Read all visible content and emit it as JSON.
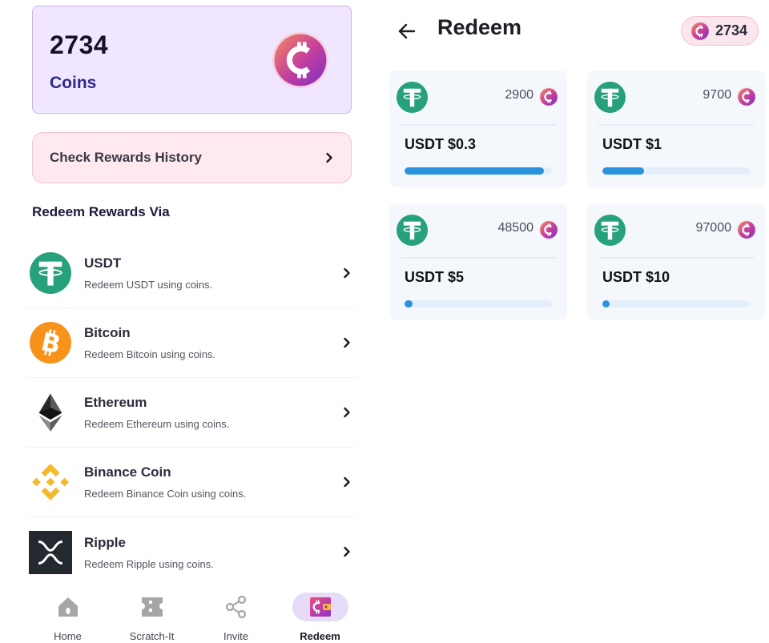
{
  "left": {
    "balance": {
      "amount": "2734",
      "label": "Coins",
      "icon": "coin-icon"
    },
    "history_button": {
      "label": "Check Rewards History",
      "icon": "chevron-right-icon"
    },
    "section_title": "Redeem Rewards Via",
    "methods": [
      {
        "name": "USDT",
        "desc": "Redeem USDT using coins.",
        "icon": "tether-icon",
        "color": "#26a17b"
      },
      {
        "name": "Bitcoin",
        "desc": "Redeem Bitcoin using coins.",
        "icon": "bitcoin-icon",
        "color": "#f7931a"
      },
      {
        "name": "Ethereum",
        "desc": "Redeem Ethereum using coins.",
        "icon": "ethereum-icon",
        "color": "#3c3c3d"
      },
      {
        "name": "Binance Coin",
        "desc": "Redeem Binance Coin using coins.",
        "icon": "binance-icon",
        "color": "#f3ba2f"
      },
      {
        "name": "Ripple",
        "desc": "Redeem Ripple using coins.",
        "icon": "ripple-icon",
        "color": "#23292f"
      }
    ],
    "bottom_nav": [
      {
        "label": "Home",
        "icon": "home-icon",
        "active": false
      },
      {
        "label": "Scratch-It",
        "icon": "ticket-icon",
        "active": false
      },
      {
        "label": "Invite",
        "icon": "share-icon",
        "active": false
      },
      {
        "label": "Redeem",
        "icon": "wallet-icon",
        "active": true
      }
    ]
  },
  "right": {
    "header": {
      "title": "Redeem",
      "back_icon": "arrow-left-icon",
      "balance": "2734"
    },
    "rewards": [
      {
        "title": "USDT $0.3",
        "cost": "2900",
        "progress": 0.943
      },
      {
        "title": "USDT $1",
        "cost": "9700",
        "progress": 0.282
      },
      {
        "title": "USDT $5",
        "cost": "48500",
        "progress": 0.056
      },
      {
        "title": "USDT $10",
        "cost": "97000",
        "progress": 0.028
      }
    ]
  },
  "colors": {
    "accent_purple": "#8a3fc7",
    "coin_gradient_start": "#f4775e",
    "coin_gradient_end": "#8b2fc9",
    "progress_blue": "#2b93dc",
    "tether_green": "#26a17b"
  }
}
